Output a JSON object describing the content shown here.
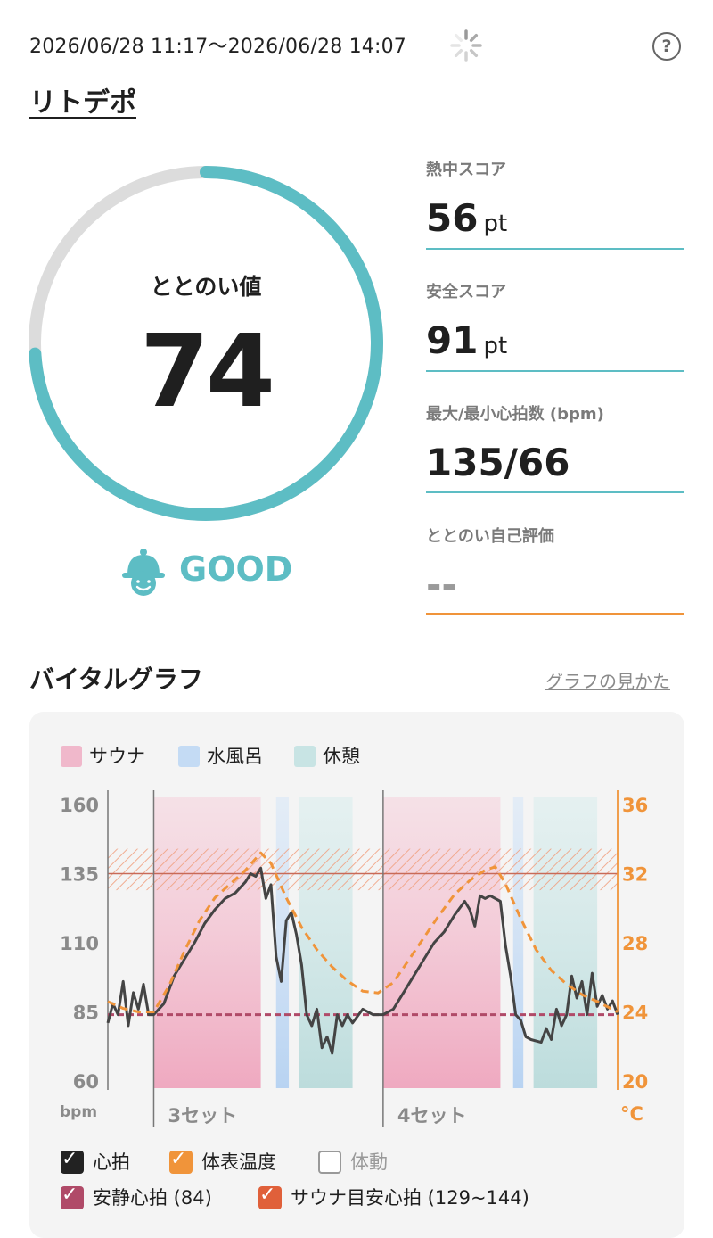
{
  "header": {
    "date_range": "2026/06/28 11:17～2026/06/28 14:07",
    "help_label": "?",
    "place_name": "リトデポ"
  },
  "score": {
    "label": "ととのい値",
    "value": "74",
    "fraction": 0.74,
    "status": "GOOD",
    "status_color": "#5dbdc4"
  },
  "metrics": [
    {
      "label": "熱中スコア",
      "value": "56",
      "unit": "pt"
    },
    {
      "label": "安全スコア",
      "value": "91",
      "unit": "pt"
    },
    {
      "label": "最大/最小心拍数 (bpm)",
      "value": "135/66",
      "unit": ""
    },
    {
      "label": "ととのい自己評価",
      "value": "--",
      "unit": ""
    }
  ],
  "vital": {
    "title": "バイタルグラフ",
    "howto_link": "グラフの見かた",
    "legend": [
      {
        "label": "サウナ",
        "color": "#f0b8cb"
      },
      {
        "label": "水風呂",
        "color": "#c4dbf4"
      },
      {
        "label": "休憩",
        "color": "#c8e4e4"
      }
    ],
    "checkboxes": [
      {
        "label": "心拍",
        "checked": true,
        "color": "#222222"
      },
      {
        "label": "体表温度",
        "checked": true,
        "color": "#f0943a"
      },
      {
        "label": "体動",
        "checked": false,
        "color": "#999999"
      },
      {
        "label": "安静心拍 (84)",
        "checked": true,
        "color": "#b04a68"
      },
      {
        "label": "サウナ目安心拍 (129~144)",
        "checked": true,
        "color": "#e0603a"
      }
    ]
  },
  "chart_data": {
    "type": "line",
    "left_axis": {
      "ticks": [
        "160",
        "135",
        "110",
        "85",
        "60"
      ],
      "unit": "bpm",
      "ylim": [
        60,
        160
      ]
    },
    "right_axis": {
      "ticks": [
        "36",
        "32",
        "28",
        "24",
        "20"
      ],
      "unit": "°C",
      "ylim": [
        20,
        36
      ]
    },
    "set_labels": [
      "3セット",
      "4セット"
    ],
    "resting_hr": 84,
    "sauna_target_range": [
      129,
      144
    ],
    "phases": [
      {
        "type": "sauna",
        "start": 0.09,
        "end": 0.3
      },
      {
        "type": "cold_bath",
        "start": 0.33,
        "end": 0.355
      },
      {
        "type": "rest",
        "start": 0.375,
        "end": 0.48
      },
      {
        "type": "sauna",
        "start": 0.54,
        "end": 0.77
      },
      {
        "type": "cold_bath",
        "start": 0.795,
        "end": 0.815
      },
      {
        "type": "rest",
        "start": 0.835,
        "end": 0.96
      }
    ],
    "series": [
      {
        "name": "心拍",
        "axis": "left",
        "points": [
          [
            0,
            81
          ],
          [
            0.01,
            88
          ],
          [
            0.02,
            84
          ],
          [
            0.03,
            96
          ],
          [
            0.04,
            80
          ],
          [
            0.05,
            92
          ],
          [
            0.06,
            86
          ],
          [
            0.07,
            95
          ],
          [
            0.08,
            84
          ],
          [
            0.09,
            84
          ],
          [
            0.11,
            88
          ],
          [
            0.13,
            98
          ],
          [
            0.15,
            104
          ],
          [
            0.17,
            110
          ],
          [
            0.19,
            117
          ],
          [
            0.21,
            122
          ],
          [
            0.23,
            126
          ],
          [
            0.25,
            128
          ],
          [
            0.27,
            132
          ],
          [
            0.28,
            135
          ],
          [
            0.29,
            134
          ],
          [
            0.3,
            137
          ],
          [
            0.31,
            126
          ],
          [
            0.32,
            131
          ],
          [
            0.33,
            105
          ],
          [
            0.34,
            96
          ],
          [
            0.35,
            118
          ],
          [
            0.36,
            121
          ],
          [
            0.37,
            113
          ],
          [
            0.38,
            102
          ],
          [
            0.39,
            84
          ],
          [
            0.4,
            80
          ],
          [
            0.41,
            86
          ],
          [
            0.42,
            72
          ],
          [
            0.43,
            76
          ],
          [
            0.44,
            70
          ],
          [
            0.45,
            84
          ],
          [
            0.46,
            80
          ],
          [
            0.47,
            84
          ],
          [
            0.48,
            81
          ],
          [
            0.5,
            86
          ],
          [
            0.52,
            84
          ],
          [
            0.54,
            84
          ],
          [
            0.56,
            86
          ],
          [
            0.58,
            92
          ],
          [
            0.6,
            98
          ],
          [
            0.62,
            104
          ],
          [
            0.64,
            110
          ],
          [
            0.66,
            114
          ],
          [
            0.68,
            120
          ],
          [
            0.7,
            125
          ],
          [
            0.71,
            122
          ],
          [
            0.72,
            116
          ],
          [
            0.73,
            127
          ],
          [
            0.74,
            126
          ],
          [
            0.75,
            127
          ],
          [
            0.77,
            125
          ],
          [
            0.78,
            109
          ],
          [
            0.79,
            98
          ],
          [
            0.8,
            84
          ],
          [
            0.81,
            82
          ],
          [
            0.82,
            76
          ],
          [
            0.83,
            75
          ],
          [
            0.85,
            74
          ],
          [
            0.86,
            79
          ],
          [
            0.87,
            75
          ],
          [
            0.88,
            86
          ],
          [
            0.89,
            80
          ],
          [
            0.9,
            84
          ],
          [
            0.91,
            98
          ],
          [
            0.92,
            90
          ],
          [
            0.93,
            96
          ],
          [
            0.94,
            84
          ],
          [
            0.95,
            99
          ],
          [
            0.96,
            87
          ],
          [
            0.97,
            91
          ],
          [
            0.98,
            86
          ],
          [
            0.99,
            89
          ],
          [
            1.0,
            84
          ]
        ]
      },
      {
        "name": "体表温度",
        "axis": "right",
        "points": [
          [
            0,
            24.6
          ],
          [
            0.03,
            24.2
          ],
          [
            0.06,
            24.0
          ],
          [
            0.09,
            24.0
          ],
          [
            0.12,
            25.5
          ],
          [
            0.15,
            27.5
          ],
          [
            0.18,
            29.3
          ],
          [
            0.21,
            30.6
          ],
          [
            0.24,
            31.4
          ],
          [
            0.27,
            32.2
          ],
          [
            0.3,
            33.2
          ],
          [
            0.32,
            32.6
          ],
          [
            0.35,
            30.6
          ],
          [
            0.38,
            28.9
          ],
          [
            0.41,
            27.6
          ],
          [
            0.44,
            26.6
          ],
          [
            0.47,
            25.8
          ],
          [
            0.5,
            25.2
          ],
          [
            0.53,
            25.1
          ],
          [
            0.56,
            25.7
          ],
          [
            0.59,
            27.0
          ],
          [
            0.62,
            28.3
          ],
          [
            0.65,
            29.6
          ],
          [
            0.68,
            30.8
          ],
          [
            0.71,
            31.6
          ],
          [
            0.74,
            32.2
          ],
          [
            0.76,
            32.4
          ],
          [
            0.78,
            31.4
          ],
          [
            0.81,
            29.4
          ],
          [
            0.84,
            27.6
          ],
          [
            0.87,
            26.4
          ],
          [
            0.9,
            25.6
          ],
          [
            0.93,
            25.0
          ],
          [
            0.96,
            24.6
          ],
          [
            1.0,
            24.0
          ]
        ]
      }
    ]
  }
}
